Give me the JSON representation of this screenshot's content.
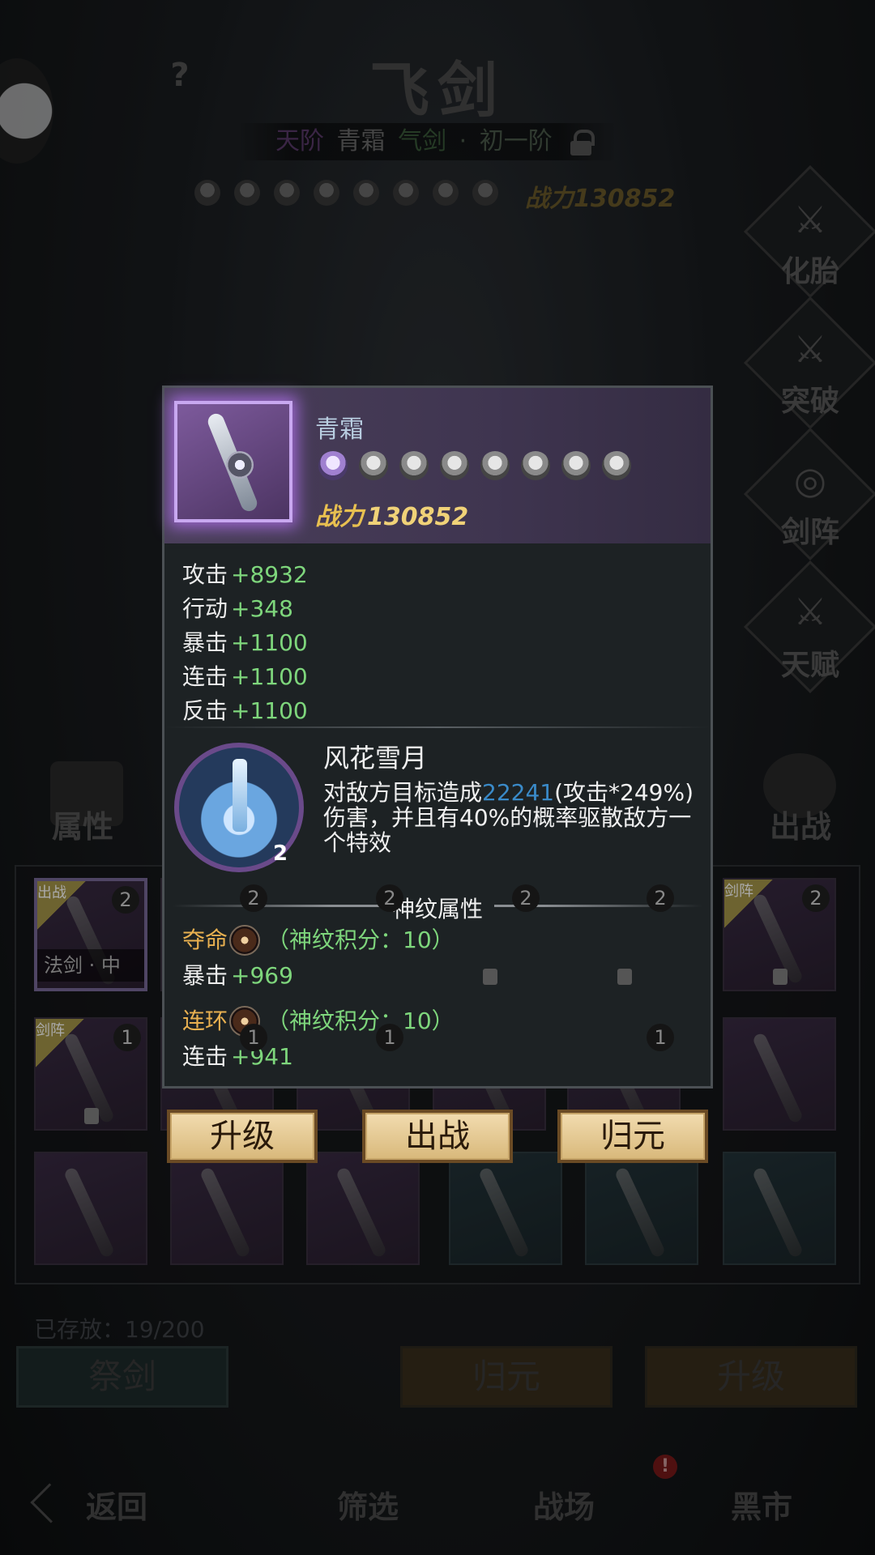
{
  "header": {
    "title": "飞剑",
    "help_icon": "?",
    "rank": {
      "tier": "天阶",
      "name": "青霜",
      "type": "气剑",
      "sep": "·",
      "stage": "初一阶"
    },
    "power_label": "战力",
    "power_value": "130852"
  },
  "side_menu": [
    {
      "label": "化胎",
      "icon": "womb-icon"
    },
    {
      "label": "突破",
      "icon": "breakthrough-icon"
    },
    {
      "label": "剑阵",
      "icon": "formation-icon"
    },
    {
      "label": "天赋",
      "icon": "talent-icon"
    }
  ],
  "left_tab": {
    "label": "属性"
  },
  "right_tab": {
    "label": "出战"
  },
  "inventory": {
    "first_slot_name": "法剑 · 中",
    "ribbon_label": "出战",
    "ribbon_label_alt": "剑阵",
    "counts": [
      "2",
      "2",
      "2",
      "2",
      "2",
      "2",
      "1",
      "1",
      "1",
      "1"
    ]
  },
  "storage": {
    "text": "已存放：19/200"
  },
  "bottom_buttons": {
    "sacrifice": "祭剑",
    "return": "归元",
    "upgrade": "升级"
  },
  "nav": {
    "back": "返回",
    "filter": "筛选",
    "battlefield": "战场",
    "market": "黑市",
    "badge": "!"
  },
  "popup": {
    "name": "青霜",
    "power_label": "战力",
    "power_value": "130852",
    "star_count": 8,
    "stats": [
      {
        "label": "攻击",
        "value": "+8932"
      },
      {
        "label": "行动",
        "value": "+348"
      },
      {
        "label": "暴击",
        "value": "+1100"
      },
      {
        "label": "连击",
        "value": "+1100"
      },
      {
        "label": "反击",
        "value": "+1100"
      }
    ],
    "skill": {
      "name": "风花雪月",
      "level": "2",
      "desc_pre": "对敌方目标造成",
      "desc_dmg": "22241",
      "desc_post": "(攻击*249%)伤害，并且有40%的概率驱散敌方一个特效"
    },
    "rune_section_title": "神纹属性",
    "runes": [
      {
        "name": "夺命",
        "score": "（神纹积分：10）",
        "stat_label": "暴击",
        "stat_value": "+969"
      },
      {
        "name": "连环",
        "score": "（神纹积分：10）",
        "stat_label": "连击",
        "stat_value": "+941"
      }
    ],
    "actions": {
      "upgrade": "升级",
      "deploy": "出战",
      "return": "归元"
    }
  },
  "colors": {
    "accent_purple": "#c8a8f0",
    "stat_green": "#7ed67c",
    "damage_blue": "#3a8ac8",
    "rune_gold": "#e8b050",
    "power_gold": "#f0d278"
  }
}
